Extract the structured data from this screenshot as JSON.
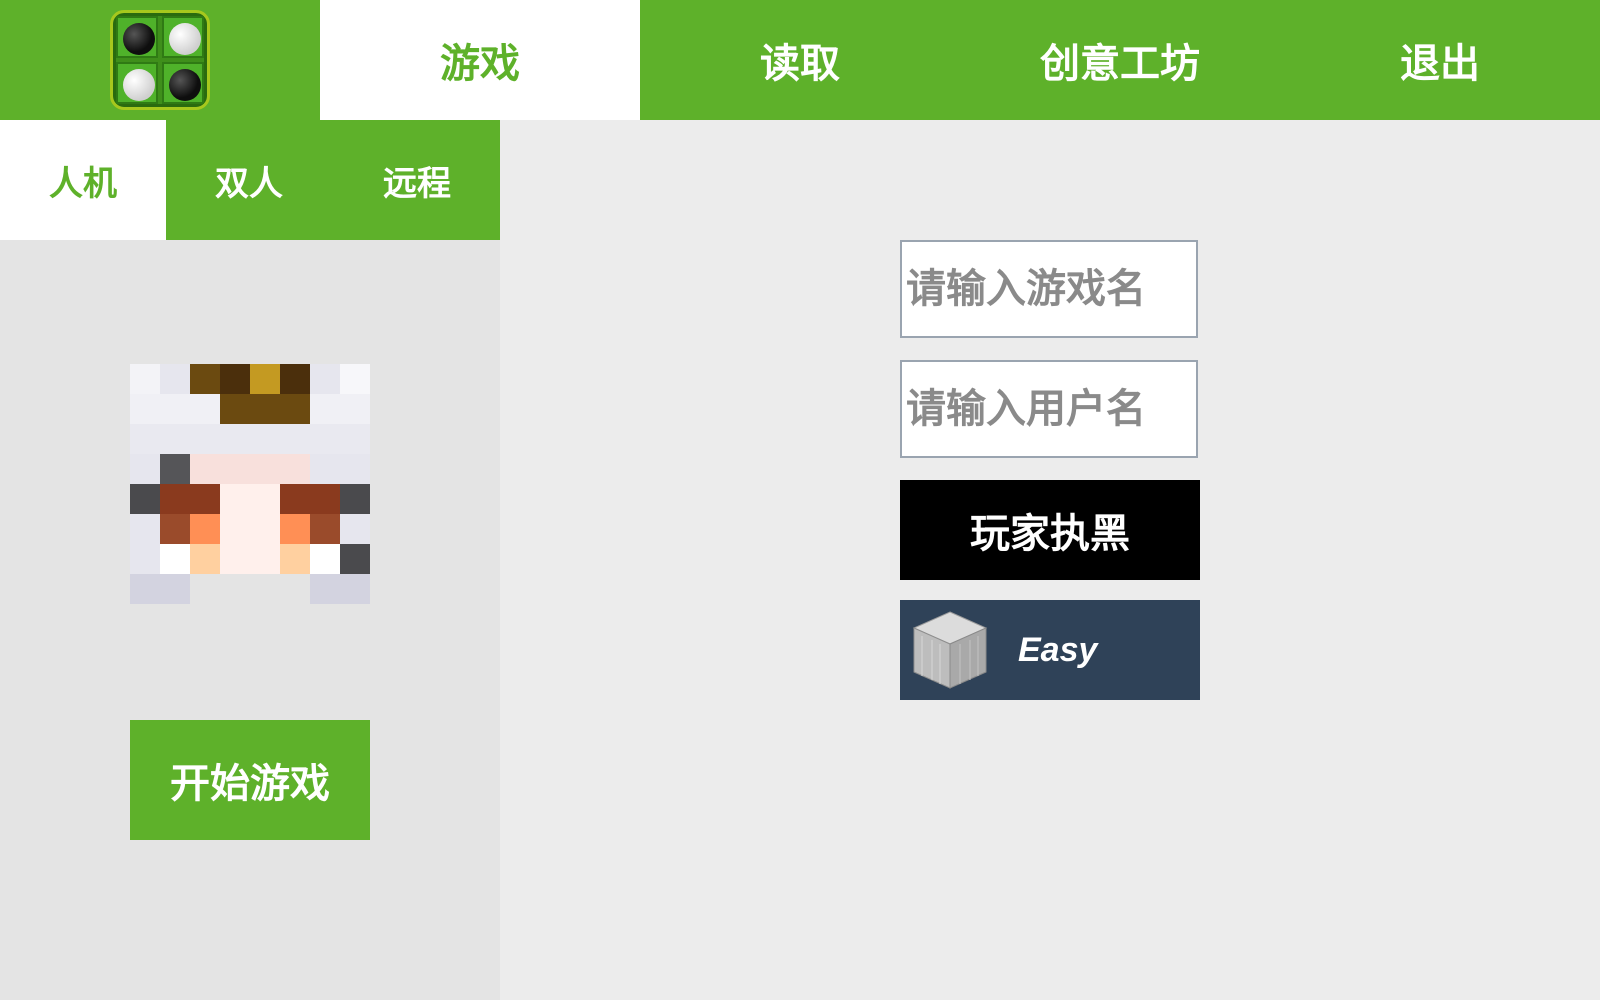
{
  "nav": {
    "tabs": [
      {
        "label": "游戏",
        "active": true
      },
      {
        "label": "读取",
        "active": false
      },
      {
        "label": "创意工坊",
        "active": false
      },
      {
        "label": "退出",
        "active": false
      }
    ]
  },
  "mode_tabs": [
    {
      "label": "人机",
      "active": true
    },
    {
      "label": "双人",
      "active": false
    },
    {
      "label": "远程",
      "active": false
    }
  ],
  "left_panel": {
    "start_button": "开始游戏"
  },
  "form": {
    "game_name_placeholder": "请输入游戏名",
    "user_name_placeholder": "请输入用户名",
    "color_button": "玩家执黑",
    "difficulty_label": "Easy"
  },
  "colors": {
    "accent": "#5eb12a",
    "content_bg": "#ececec",
    "left_panel_bg": "#e4e4e4",
    "difficulty_bg": "#2f4258"
  },
  "icons": {
    "logo": "reversi-board-logo-icon",
    "avatar": "pixel-avatar-icon",
    "difficulty": "iron-block-icon"
  }
}
